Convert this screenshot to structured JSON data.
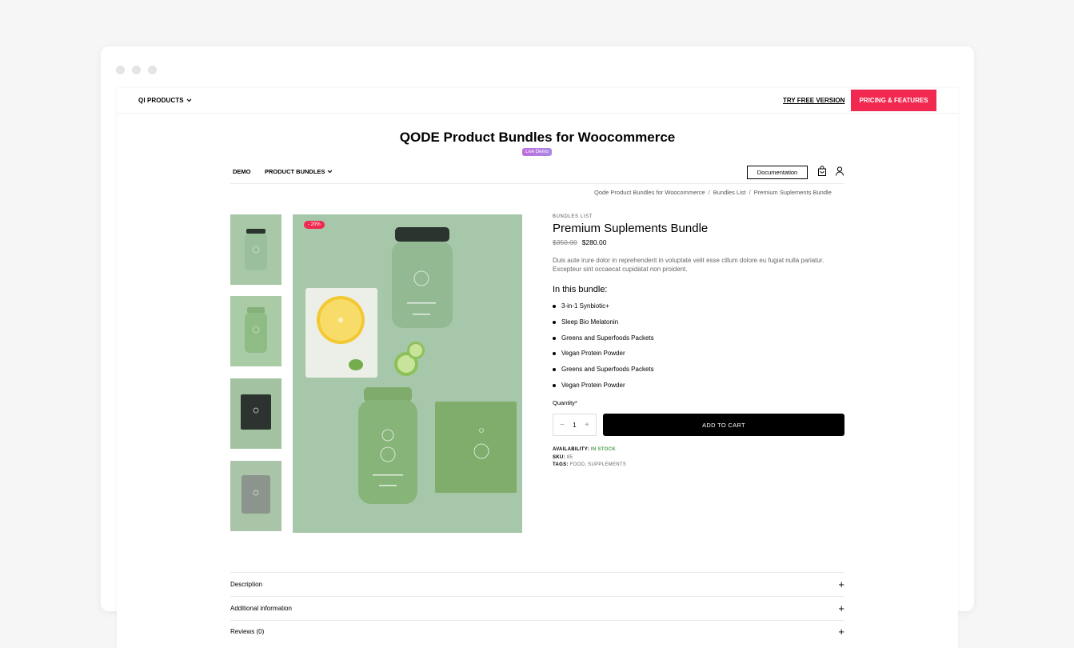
{
  "topbar": {
    "qi_products": "QI PRODUCTS",
    "try_free": "TRY FREE VERSION",
    "pricing": "PRICING & FEATURES"
  },
  "page": {
    "title": "QODE Product Bundles for Woocommerce",
    "live_demo": "Live Demo"
  },
  "site_nav": {
    "demo": "DEMO",
    "product_bundles": "PRODUCT BUNDLES",
    "documentation": "Documentation"
  },
  "breadcrumb": {
    "items": [
      "Qode Product Bundles for Woocommerce",
      "Bundles List",
      "Premium Suplements Bundle"
    ],
    "separator": "/"
  },
  "product": {
    "sale_badge": "- 20%",
    "category": "BUNDLES LIST",
    "title": "Premium Suplements Bundle",
    "old_price": "$350.00",
    "price": "$280.00",
    "description": "Duis aute irure dolor in reprehenderit in voluptate velit esse cillum dolore eu fugiat nulla pariatur. Excepteur sint occaecat cupidatat non proident.",
    "bundle_heading": "In this bundle:",
    "bundle_items": [
      "3-in-1 Synbiotic+",
      "Sleep Bio Melatonin",
      "Greens and Superfoods Packets",
      "Vegan Protein Powder",
      "Greens and Superfoods Packets",
      "Vegan Protein Powder"
    ],
    "quantity_label": "Quantity*",
    "quantity": "1",
    "add_to_cart": "ADD TO CART",
    "availability_label": "AVAILABILITY:",
    "availability_value": "IN STOCK",
    "sku_label": "SKU:",
    "sku_value": "85",
    "tags_label": "TAGS:",
    "tags_value": "FOOD,  SUPPLEMENTS"
  },
  "accordion": [
    "Description",
    "Additional information",
    "Reviews (0)"
  ],
  "colors": {
    "accent": "#f1284f",
    "product_bg": "#a6c7a9",
    "in_stock": "#4fa14a"
  }
}
